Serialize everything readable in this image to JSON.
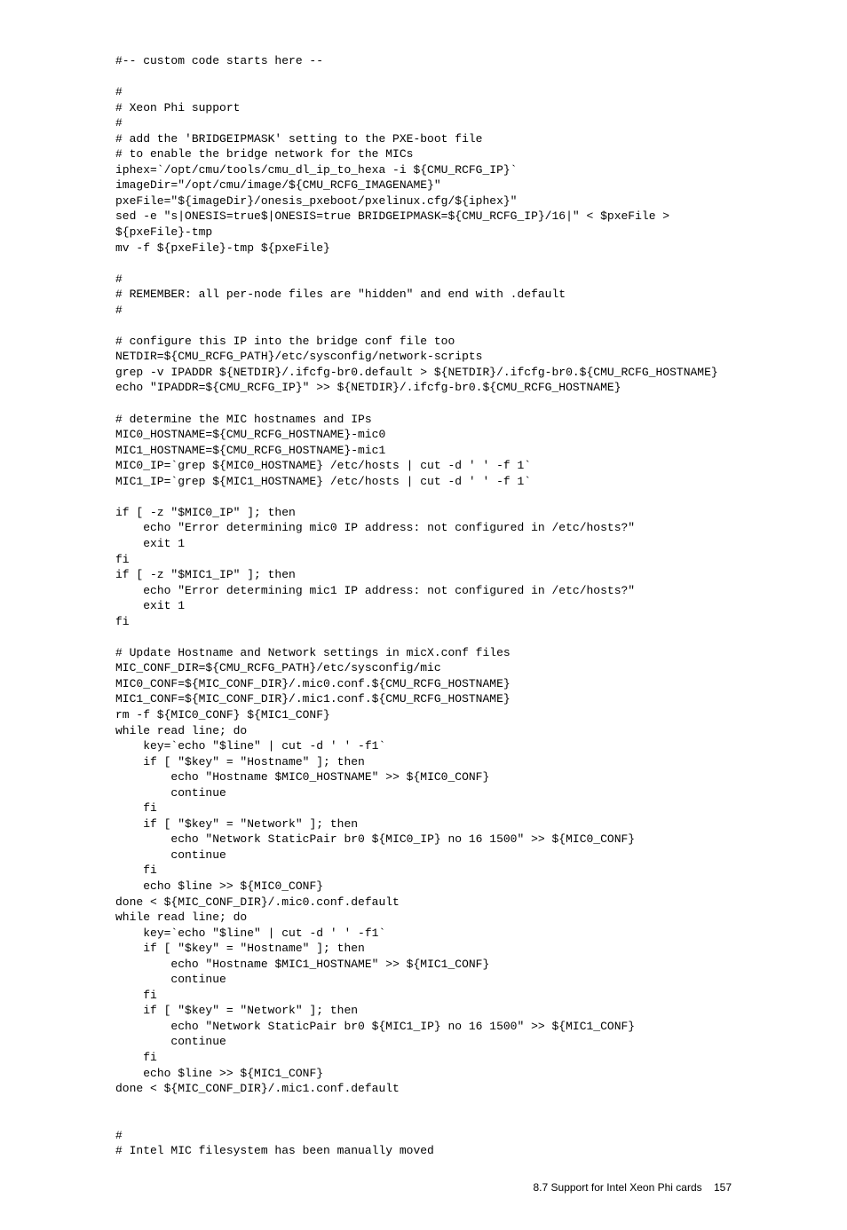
{
  "code": "#-- custom code starts here --\n\n#\n# Xeon Phi support\n#\n# add the 'BRIDGEIPMASK' setting to the PXE-boot file\n# to enable the bridge network for the MICs\niphex=`/opt/cmu/tools/cmu_dl_ip_to_hexa -i ${CMU_RCFG_IP}`\nimageDir=\"/opt/cmu/image/${CMU_RCFG_IMAGENAME}\"\npxeFile=\"${imageDir}/onesis_pxeboot/pxelinux.cfg/${iphex}\"\nsed -e \"s|ONESIS=true$|ONESIS=true BRIDGEIPMASK=${CMU_RCFG_IP}/16|\" < $pxeFile > ${pxeFile}-tmp\nmv -f ${pxeFile}-tmp ${pxeFile}\n\n#\n# REMEMBER: all per-node files are \"hidden\" and end with .default\n#\n\n# configure this IP into the bridge conf file too\nNETDIR=${CMU_RCFG_PATH}/etc/sysconfig/network-scripts\ngrep -v IPADDR ${NETDIR}/.ifcfg-br0.default > ${NETDIR}/.ifcfg-br0.${CMU_RCFG_HOSTNAME}\necho \"IPADDR=${CMU_RCFG_IP}\" >> ${NETDIR}/.ifcfg-br0.${CMU_RCFG_HOSTNAME}\n\n# determine the MIC hostnames and IPs\nMIC0_HOSTNAME=${CMU_RCFG_HOSTNAME}-mic0\nMIC1_HOSTNAME=${CMU_RCFG_HOSTNAME}-mic1\nMIC0_IP=`grep ${MIC0_HOSTNAME} /etc/hosts | cut -d ' ' -f 1`\nMIC1_IP=`grep ${MIC1_HOSTNAME} /etc/hosts | cut -d ' ' -f 1`\n\nif [ -z \"$MIC0_IP\" ]; then\n    echo \"Error determining mic0 IP address: not configured in /etc/hosts?\"\n    exit 1\nfi\nif [ -z \"$MIC1_IP\" ]; then\n    echo \"Error determining mic1 IP address: not configured in /etc/hosts?\"\n    exit 1\nfi\n\n# Update Hostname and Network settings in micX.conf files\nMIC_CONF_DIR=${CMU_RCFG_PATH}/etc/sysconfig/mic\nMIC0_CONF=${MIC_CONF_DIR}/.mic0.conf.${CMU_RCFG_HOSTNAME}\nMIC1_CONF=${MIC_CONF_DIR}/.mic1.conf.${CMU_RCFG_HOSTNAME}\nrm -f ${MIC0_CONF} ${MIC1_CONF}\nwhile read line; do\n    key=`echo \"$line\" | cut -d ' ' -f1`\n    if [ \"$key\" = \"Hostname\" ]; then\n        echo \"Hostname $MIC0_HOSTNAME\" >> ${MIC0_CONF}\n        continue\n    fi\n    if [ \"$key\" = \"Network\" ]; then\n        echo \"Network StaticPair br0 ${MIC0_IP} no 16 1500\" >> ${MIC0_CONF}\n        continue\n    fi\n    echo $line >> ${MIC0_CONF}\ndone < ${MIC_CONF_DIR}/.mic0.conf.default\nwhile read line; do\n    key=`echo \"$line\" | cut -d ' ' -f1`\n    if [ \"$key\" = \"Hostname\" ]; then\n        echo \"Hostname $MIC1_HOSTNAME\" >> ${MIC1_CONF}\n        continue\n    fi\n    if [ \"$key\" = \"Network\" ]; then\n        echo \"Network StaticPair br0 ${MIC1_IP} no 16 1500\" >> ${MIC1_CONF}\n        continue\n    fi\n    echo $line >> ${MIC1_CONF}\ndone < ${MIC_CONF_DIR}/.mic1.conf.default\n\n\n#\n# Intel MIC filesystem has been manually moved",
  "footer": {
    "section": "8.7 Support for Intel Xeon Phi cards",
    "page": "157"
  }
}
